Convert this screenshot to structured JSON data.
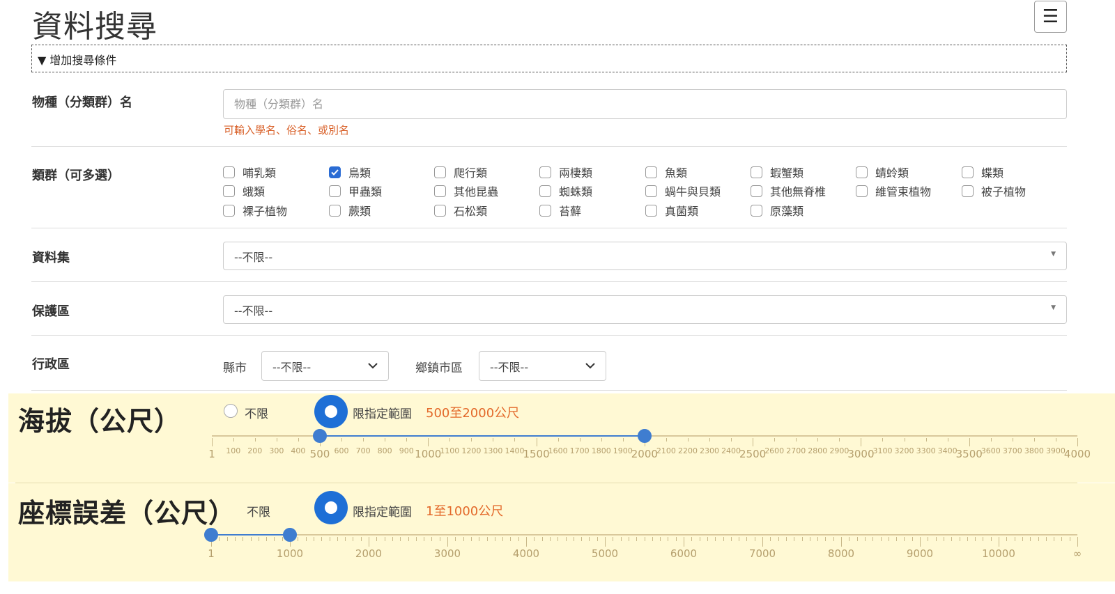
{
  "page": {
    "title": "資料搜尋",
    "menu_icon": "hamburger-icon"
  },
  "advanced_toggle": {
    "label": "▼ 增加搜尋條件"
  },
  "species": {
    "label": "物種（分類群）名",
    "placeholder": "物種（分類群）名",
    "hint": "可輸入學名、俗名、或別名"
  },
  "groups": {
    "label": "類群（可多選）",
    "items": [
      {
        "label": "哺乳類",
        "checked": false
      },
      {
        "label": "鳥類",
        "checked": true
      },
      {
        "label": "爬行類",
        "checked": false
      },
      {
        "label": "兩棲類",
        "checked": false
      },
      {
        "label": "魚類",
        "checked": false
      },
      {
        "label": "蝦蟹類",
        "checked": false
      },
      {
        "label": "蜻蛉類",
        "checked": false
      },
      {
        "label": "蝶類",
        "checked": false
      },
      {
        "label": "蛾類",
        "checked": false
      },
      {
        "label": "甲蟲類",
        "checked": false
      },
      {
        "label": "其他昆蟲",
        "checked": false
      },
      {
        "label": "蜘蛛類",
        "checked": false
      },
      {
        "label": "蝸牛與貝類",
        "checked": false
      },
      {
        "label": "其他無脊椎",
        "checked": false
      },
      {
        "label": "維管束植物",
        "checked": false
      },
      {
        "label": "被子植物",
        "checked": false
      },
      {
        "label": "裸子植物",
        "checked": false
      },
      {
        "label": "蕨類",
        "checked": false
      },
      {
        "label": "石松類",
        "checked": false
      },
      {
        "label": "苔蘚",
        "checked": false
      },
      {
        "label": "真菌類",
        "checked": false
      },
      {
        "label": "原藻類",
        "checked": false
      }
    ]
  },
  "dataset": {
    "label": "資料集",
    "value": "--不限--"
  },
  "protected_area": {
    "label": "保護區",
    "value": "--不限--"
  },
  "admin": {
    "label": "行政區",
    "county_label": "縣市",
    "county_value": "--不限--",
    "town_label": "鄉鎮市區",
    "town_value": "--不限--"
  },
  "elevation": {
    "label": "海拔（公尺）",
    "opt_unlimited": "不限",
    "opt_range": "限指定範圍",
    "range_text": "500至2000公尺",
    "range_low": 500,
    "range_high": 2000,
    "scale_min": 1,
    "scale_max": 4000,
    "major_ticks": [
      "1",
      "500",
      "1000",
      "1500",
      "2000",
      "2500",
      "3000",
      "3500",
      "4000"
    ],
    "minor_ticks": [
      "100",
      "200",
      "300",
      "400",
      "600",
      "700",
      "800",
      "900",
      "1100",
      "1200",
      "1300",
      "1400",
      "1600",
      "1700",
      "1800",
      "1900",
      "2100",
      "2200",
      "2300",
      "2400",
      "2600",
      "2700",
      "2800",
      "2900",
      "3100",
      "3200",
      "3300",
      "3400",
      "3600",
      "3700",
      "3800",
      "3900"
    ]
  },
  "coord_error": {
    "label": "座標誤差（公尺）",
    "opt_unlimited": "不限",
    "opt_range": "限指定範圍",
    "range_text": "1至1000公尺",
    "range_low": 1,
    "range_high": 1000,
    "major_ticks": [
      "1",
      "1000",
      "2000",
      "3000",
      "4000",
      "5000",
      "6000",
      "7000",
      "8000",
      "9000",
      "10000",
      "∞"
    ]
  },
  "colors": {
    "accent": "#1e6fd6",
    "highlight_text": "#e3692a",
    "band_bg": "#fff9d4"
  }
}
